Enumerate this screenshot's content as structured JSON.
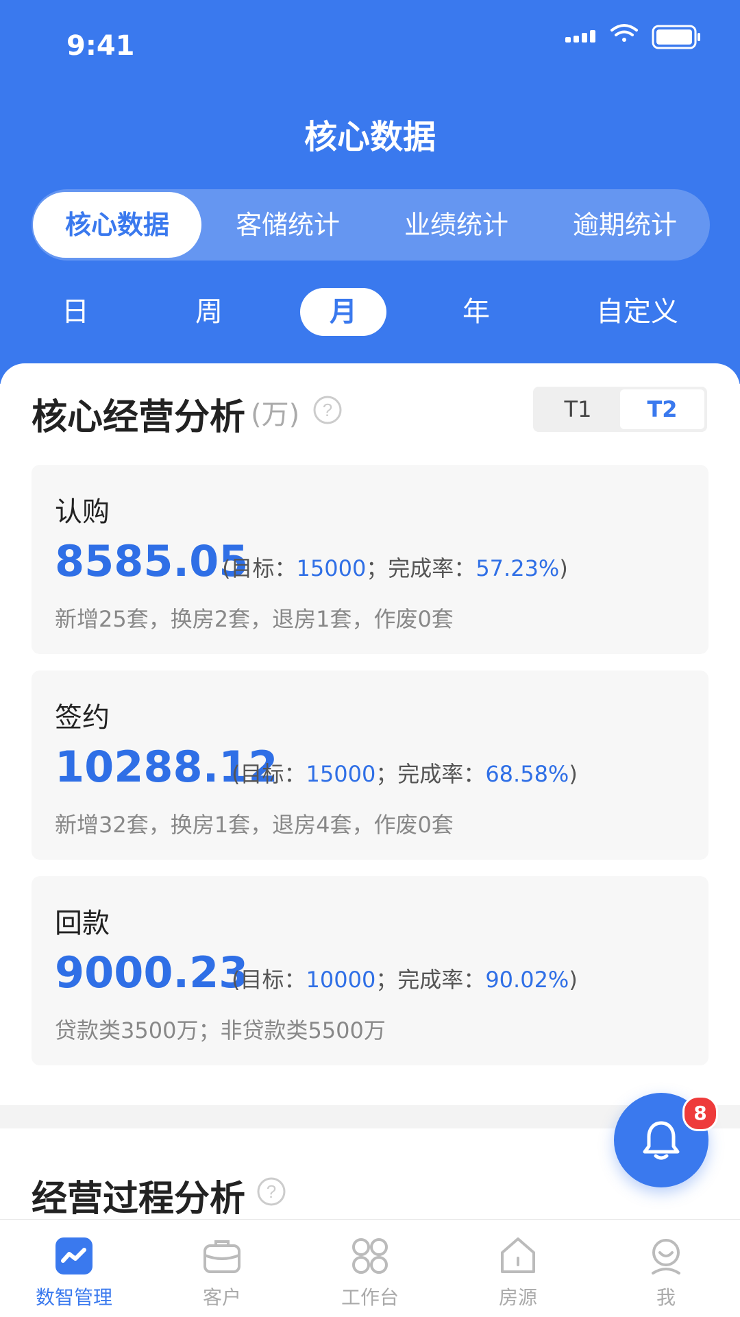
{
  "status_bar": {
    "time": "9:41"
  },
  "header": {
    "title": "核心数据"
  },
  "tabs": [
    {
      "label": "核心数据",
      "active": true
    },
    {
      "label": "客储统计",
      "active": false
    },
    {
      "label": "业绩统计",
      "active": false
    },
    {
      "label": "逾期统计",
      "active": false
    }
  ],
  "periods": [
    {
      "label": "日",
      "active": false
    },
    {
      "label": "周",
      "active": false
    },
    {
      "label": "月",
      "active": true
    },
    {
      "label": "年",
      "active": false
    },
    {
      "label": "自定义",
      "active": false
    }
  ],
  "core_section": {
    "title": "核心经营分析",
    "unit": "(万)",
    "segments": [
      {
        "label": "T1",
        "active": false
      },
      {
        "label": "T2",
        "active": true
      }
    ],
    "metrics": [
      {
        "label": "认购",
        "value": "8585.05",
        "meta_open": "(目标：",
        "target": "15000",
        "meta_mid": "；完成率：",
        "rate": "57.23%",
        "meta_close": ")",
        "detail": "新增25套，换房2套，退房1套，作废0套"
      },
      {
        "label": "签约",
        "value": "10288.12",
        "meta_open": "(目标：",
        "target": "15000",
        "meta_mid": "；完成率：",
        "rate": "68.58%",
        "meta_close": ")",
        "detail": "新增32套，换房1套，退房4套，作废0套"
      },
      {
        "label": "回款",
        "value": "9000.23",
        "meta_open": "(目标：",
        "target": "10000",
        "meta_mid": "；完成率：",
        "rate": "90.02%",
        "meta_close": ")",
        "detail": "贷款类3500万；非贷款类5500万"
      }
    ]
  },
  "process_section": {
    "title": "经营过程分析"
  },
  "notification": {
    "badge": "8"
  },
  "tabbar": [
    {
      "label": "数智管理",
      "icon": "chart-line-icon",
      "active": true
    },
    {
      "label": "客户",
      "icon": "briefcase-icon",
      "active": false
    },
    {
      "label": "工作台",
      "icon": "grid-icon",
      "active": false
    },
    {
      "label": "房源",
      "icon": "house-icon",
      "active": false
    },
    {
      "label": "我",
      "icon": "user-icon",
      "active": false
    }
  ],
  "colors": {
    "primary": "#3a79ee",
    "badge": "#ee3b3b"
  }
}
